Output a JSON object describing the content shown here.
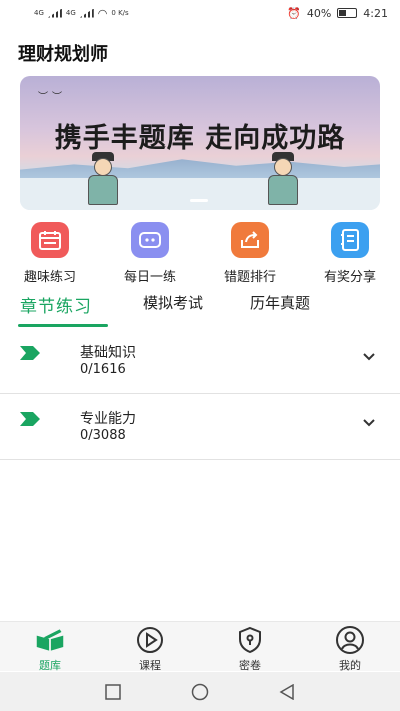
{
  "status_bar": {
    "signal_1": "4G",
    "signal_2": "4G",
    "speed": "0 K/s",
    "battery": "40%",
    "time": "4:21"
  },
  "header": {
    "title": "理财规划师"
  },
  "banner": {
    "text": "携手丰题库 走向成功路"
  },
  "quick_menu": [
    {
      "label": "趣味练习",
      "icon": "calendar-icon",
      "color": "#f05a5a"
    },
    {
      "label": "每日一练",
      "icon": "robot-icon",
      "color": "#8a8ff0"
    },
    {
      "label": "错题排行",
      "icon": "share-icon",
      "color": "#f07a3c"
    },
    {
      "label": "有奖分享",
      "icon": "notebook-icon",
      "color": "#3ca0f0"
    }
  ],
  "tabs": [
    {
      "label": "章节练习",
      "active": true
    },
    {
      "label": "模拟考试",
      "active": false
    },
    {
      "label": "历年真题",
      "active": false
    }
  ],
  "chapters": [
    {
      "name": "基础知识",
      "progress": "0/1616"
    },
    {
      "name": "专业能力",
      "progress": "0/3088"
    }
  ],
  "bottom_nav": [
    {
      "label": "题库",
      "icon": "book-icon",
      "active": true
    },
    {
      "label": "课程",
      "icon": "play-icon",
      "active": false
    },
    {
      "label": "密卷",
      "icon": "shield-lock-icon",
      "active": false
    },
    {
      "label": "我的",
      "icon": "user-icon",
      "active": false
    }
  ],
  "colors": {
    "accent": "#1aa561"
  }
}
